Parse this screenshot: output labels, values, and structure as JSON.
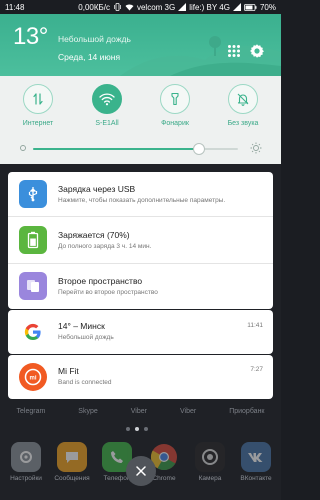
{
  "status_bar": {
    "time": "11:48",
    "net_speed": "0,00КБ/с",
    "carrier1": "velcom 3G",
    "carrier2": "life:) BY 4G",
    "battery": "70%"
  },
  "weather": {
    "temperature": "13°",
    "description": "Небольшой дождь",
    "date": "Среда, 14 июня"
  },
  "quick_settings": {
    "tiles": [
      {
        "label": "Интернет",
        "icon": "data-transfer-icon",
        "active": false
      },
      {
        "label": "S-E1All",
        "icon": "wifi-icon",
        "active": true
      },
      {
        "label": "Фонарик",
        "icon": "flashlight-icon",
        "active": false
      },
      {
        "label": "Без звука",
        "icon": "bell-mute-icon",
        "active": false
      }
    ],
    "brightness_level": 0.81
  },
  "notifications": [
    {
      "title": "Зарядка через USB",
      "text": "Нажмите, чтобы показать дополнительные параметры.",
      "time": "",
      "icon": "usb-icon",
      "color": "#3b8fdc"
    },
    {
      "title": "Заряжается (70%)",
      "text": "До полного заряда 3 ч. 14 мин.",
      "time": "",
      "icon": "battery-icon",
      "color": "#5bb63f"
    },
    {
      "title": "Второе пространство",
      "text": "Перейти во второе пространство",
      "time": "",
      "icon": "second-space-icon",
      "color": "#9a86dd"
    },
    {
      "title": "14° – Минск",
      "text": "Небольшой дождь",
      "time": "11:41",
      "icon": "google-icon",
      "color": "#ffffff"
    },
    {
      "title": "Mi Fit",
      "text": "Band is connected",
      "time": "7:27",
      "icon": "mi-fit-icon",
      "color": "#f15a22"
    }
  ],
  "home": {
    "row_labels": [
      "Telegram",
      "Skype",
      "Viber",
      "Viber",
      "Приорбанк"
    ],
    "dock": [
      {
        "label": "Настройки",
        "icon": "settings-icon",
        "color": "#8d949c"
      },
      {
        "label": "Сообщения",
        "icon": "messages-icon",
        "color": "#f5a623"
      },
      {
        "label": "Телефон",
        "icon": "phone-icon",
        "color": "#43b649"
      },
      {
        "label": "Chrome",
        "icon": "chrome-icon",
        "color": "#e8e8e8"
      },
      {
        "label": "Камера",
        "icon": "camera-icon",
        "color": "#2a2a2a"
      },
      {
        "label": "ВКонтакте",
        "icon": "vk-icon",
        "color": "#4a76a8"
      }
    ]
  },
  "colors": {
    "accent": "#3ab38c",
    "header": "#3bb08f"
  }
}
